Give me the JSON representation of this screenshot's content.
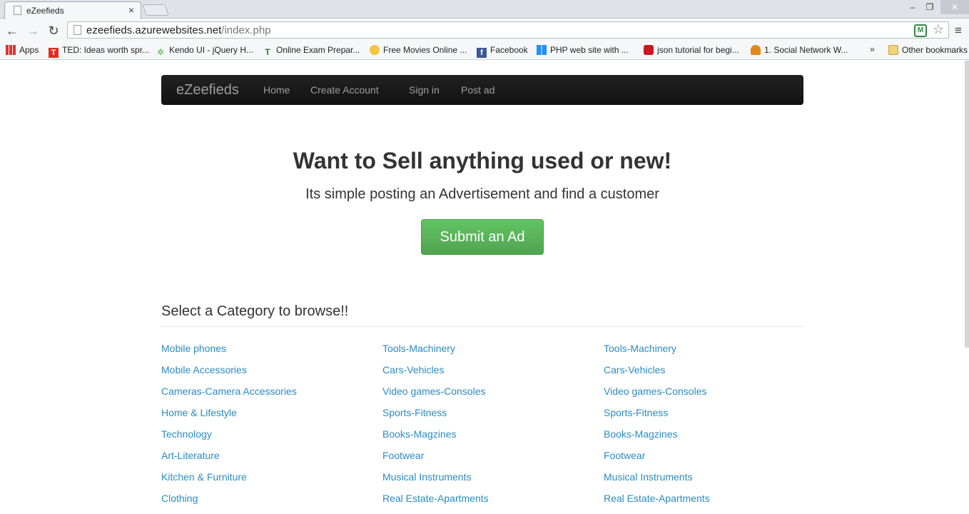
{
  "browser": {
    "tab_title": "eZeefieds",
    "tab_close": "×",
    "window_controls": {
      "minimize": "–",
      "maximize": "❐",
      "close": "✕"
    },
    "url_host": "ezeefieds.azurewebsites.net",
    "url_path": "/index.php",
    "bookmarks": [
      {
        "label": "Apps",
        "icon": "apps-grid-icon"
      },
      {
        "label": "TED: Ideas worth spr...",
        "icon": "ted-icon"
      },
      {
        "label": "Kendo UI - jQuery H...",
        "icon": "kendo-icon"
      },
      {
        "label": "Online Exam Prepar...",
        "icon": "t-logo-icon"
      },
      {
        "label": "Free Movies Online ...",
        "icon": "smiley-icon"
      },
      {
        "label": "Facebook",
        "icon": "facebook-icon"
      },
      {
        "label": "PHP web site with ...",
        "icon": "windows-icon"
      },
      {
        "label": "json tutorial for begi...",
        "icon": "youtube-icon"
      },
      {
        "label": "1. Social Network W...",
        "icon": "social-network-icon"
      }
    ],
    "bookmarks_more": "»",
    "other_bookmarks": "Other bookmarks"
  },
  "navbar": {
    "brand": "eZeefieds",
    "links": [
      "Home",
      "Create Account",
      "Sign in",
      "Post ad"
    ]
  },
  "hero": {
    "title": "Want to Sell anything used or new!",
    "subtitle": "Its simple posting an Advertisement and find a customer",
    "button": "Submit an Ad"
  },
  "categories": {
    "heading": "Select a Category to browse!!",
    "columns": [
      [
        "Mobile phones",
        "Mobile Accessories",
        "Cameras-Camera Accessories",
        "Home & Lifestyle",
        "Technology",
        "Art-Literature",
        "Kitchen & Furniture",
        "Clothing"
      ],
      [
        "Tools-Machinery",
        "Cars-Vehicles",
        "Video games-Consoles",
        "Sports-Fitness",
        "Books-Magzines",
        "Footwear",
        "Musical Instruments",
        "Real Estate-Apartments"
      ],
      [
        "Tools-Machinery",
        "Cars-Vehicles",
        "Video games-Consoles",
        "Sports-Fitness",
        "Books-Magzines",
        "Footwear",
        "Musical Instruments",
        "Real Estate-Apartments"
      ]
    ]
  },
  "colors": {
    "navbar_bg": "#1b1b1b",
    "link": "#2a8bc4",
    "button_green": "#5bb75b"
  }
}
